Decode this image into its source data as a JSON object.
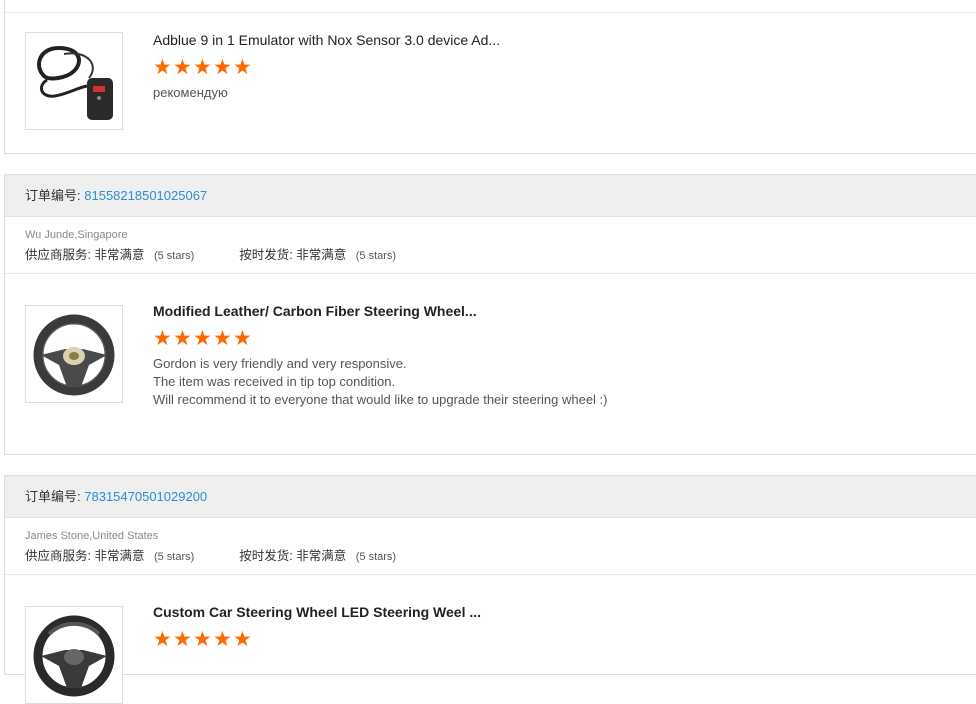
{
  "top_item": {
    "title": "Adblue 9 in 1 Emulator with Nox Sensor 3.0 device Ad...",
    "rating_stars": 5,
    "comment": "рекомендую",
    "thumb_icon": "adblue-emulator-device"
  },
  "orders": [
    {
      "order_label": "订单编号:",
      "order_number": "81558218501025067",
      "buyer": "Wu Junde,Singapore",
      "supplier_label": "供应商服务:",
      "supplier_value": "非常满意",
      "supplier_stars": "(5 stars)",
      "delivery_label": "按时发货:",
      "delivery_value": "非常满意",
      "delivery_stars": "(5 stars)",
      "item": {
        "title": "Modified Leather/ Carbon Fiber Steering Wheel...",
        "rating_stars": 5,
        "comment_lines": [
          "Gordon is very friendly and very responsive.",
          "The item was received in tip top condition.",
          "Will recommend it to everyone that would like to upgrade their steering wheel :)"
        ],
        "thumb_icon": "steering-wheel"
      }
    },
    {
      "order_label": "订单编号:",
      "order_number": "78315470501029200",
      "buyer": "James Stone,United States",
      "supplier_label": "供应商服务:",
      "supplier_value": "非常满意",
      "supplier_stars": "(5 stars)",
      "delivery_label": "按时发货:",
      "delivery_value": "非常满意",
      "delivery_stars": "(5 stars)",
      "item": {
        "title": "Custom Car Steering Wheel LED Steering Weel ...",
        "rating_stars": 5,
        "thumb_icon": "led-steering-wheel"
      }
    }
  ],
  "colors": {
    "star": "#ff6a00",
    "order_number": "#2a8fd3"
  }
}
